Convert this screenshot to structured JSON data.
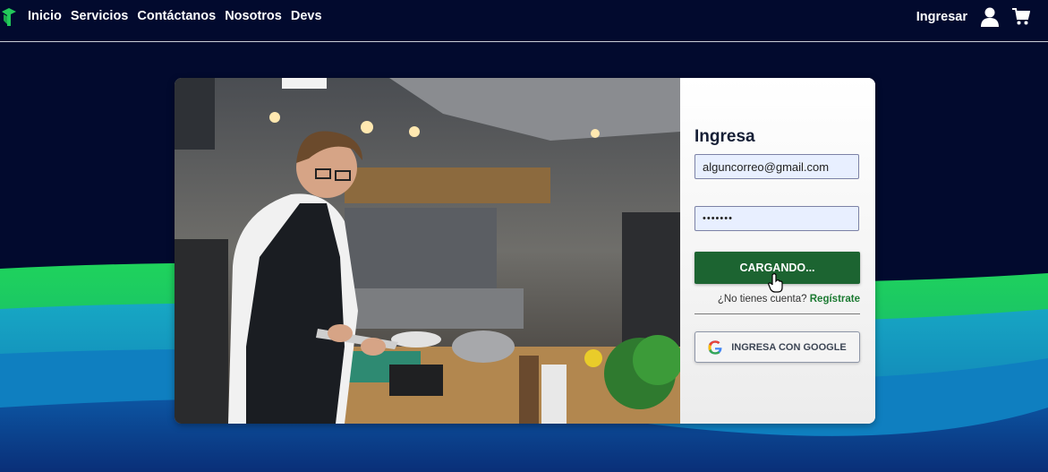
{
  "navbar": {
    "links": [
      "Inicio",
      "Servicios",
      "Contáctanos",
      "Nosotros",
      "Devs"
    ],
    "login_label": "Ingresar",
    "icons": {
      "logo": "brand-logo-icon",
      "user": "user-icon",
      "cart": "cart-icon"
    }
  },
  "login": {
    "title": "Ingresa",
    "email_value": "alguncorreo@gmail.com",
    "password_value": "•••••••",
    "submit_label": "CARGANDO...",
    "signup_prompt": "¿No tienes cuenta?",
    "signup_link": "Regístrate",
    "google_label": "INGRESA CON GOOGLE"
  },
  "colors": {
    "background": "#020a2e",
    "primary_button": "#1c6431",
    "accent_green": "#1c7a32",
    "wave_green": "#22c95a",
    "wave_blue": "#1399c9"
  }
}
